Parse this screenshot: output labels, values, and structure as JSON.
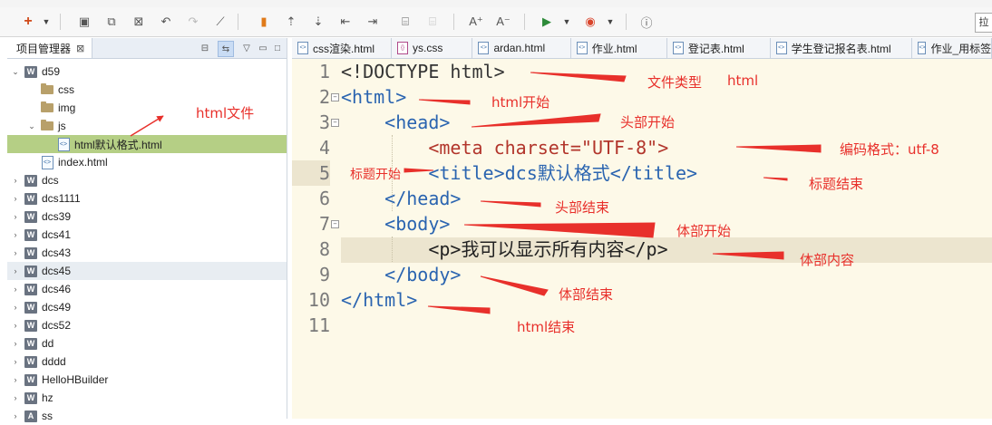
{
  "project_explorer": {
    "tab_label": "项目管理器",
    "tree": [
      {
        "label": "d59",
        "type": "web-project",
        "expanded": true,
        "depth": 0
      },
      {
        "label": "css",
        "type": "folder",
        "depth": 1
      },
      {
        "label": "img",
        "type": "folder",
        "depth": 1
      },
      {
        "label": "js",
        "type": "folder",
        "expanded": true,
        "depth": 1
      },
      {
        "label": "html默认格式.html",
        "type": "html-file",
        "depth": 2,
        "selected": true
      },
      {
        "label": "index.html",
        "type": "html-file",
        "depth": 1
      },
      {
        "label": "dcs",
        "type": "web-project",
        "depth": 0
      },
      {
        "label": "dcs1111",
        "type": "web-project",
        "depth": 0
      },
      {
        "label": "dcs39",
        "type": "web-project",
        "depth": 0
      },
      {
        "label": "dcs41",
        "type": "web-project",
        "depth": 0
      },
      {
        "label": "dcs43",
        "type": "web-project",
        "depth": 0
      },
      {
        "label": "dcs45",
        "type": "web-project",
        "depth": 0,
        "hover": true
      },
      {
        "label": "dcs46",
        "type": "web-project",
        "depth": 0
      },
      {
        "label": "dcs49",
        "type": "web-project",
        "depth": 0
      },
      {
        "label": "dcs52",
        "type": "web-project",
        "depth": 0
      },
      {
        "label": "dd",
        "type": "web-project",
        "depth": 0
      },
      {
        "label": "dddd",
        "type": "web-project",
        "depth": 0
      },
      {
        "label": "HelloHBuilder",
        "type": "web-project",
        "depth": 0
      },
      {
        "label": "hz",
        "type": "web-project",
        "depth": 0
      },
      {
        "label": "ss",
        "type": "app-project",
        "depth": 0
      }
    ]
  },
  "editor_tabs": [
    {
      "label": "css渲染.html",
      "type": "html"
    },
    {
      "label": "ys.css",
      "type": "css"
    },
    {
      "label": "ardan.html",
      "type": "html"
    },
    {
      "label": "作业.html",
      "type": "html"
    },
    {
      "label": "登记表.html",
      "type": "html"
    },
    {
      "label": "学生登记报名表.html",
      "type": "html"
    },
    {
      "label": "作业_用标签",
      "type": "html"
    }
  ],
  "code": {
    "line_numbers": [
      "1",
      "2",
      "3",
      "4",
      "5",
      "6",
      "7",
      "8",
      "9",
      "10",
      "11"
    ],
    "active_line": "5",
    "lines": [
      "<!DOCTYPE html>",
      "<html>",
      "    <head>",
      "        <meta charset=\"UTF-8\">",
      "        <title>dcs默认格式</title>",
      "    </head>",
      "    <body>",
      "        <p>我可以显示所有内容</p>",
      "    </body>",
      "</html>",
      ""
    ]
  },
  "annotations": {
    "doctype_a": "文件类型",
    "doctype_b": "html",
    "html_start": "html开始",
    "head_start": "头部开始",
    "charset": "编码格式：utf-8",
    "title_start": "标题开始",
    "title_end": "标题结束",
    "head_end": "头部结束",
    "body_start": "体部开始",
    "body_content": "体部内容",
    "body_end": "体部结束",
    "html_end": "html结束",
    "html_file": "html文件"
  },
  "colors": {
    "annotation": "#e8302b",
    "tag": "#2a64b0",
    "attr": "#b2352b",
    "editor_bg": "#fdf9e8",
    "selected": "#b5cf85"
  }
}
